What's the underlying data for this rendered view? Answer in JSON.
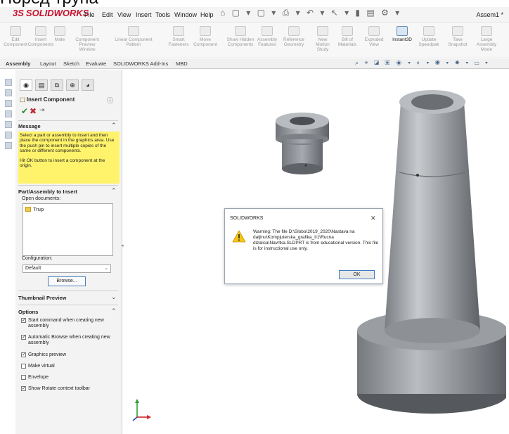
{
  "caption": "Поред трупа",
  "app": {
    "name": "SOLIDWORKS",
    "logo_mark": "3S"
  },
  "menu": {
    "items": [
      "File",
      "Edit",
      "View",
      "Insert",
      "Tools",
      "Window",
      "Help"
    ]
  },
  "document_title": "Assem1 *",
  "ribbon": {
    "buttons": [
      {
        "label": "Edit Component"
      },
      {
        "label": "Insert Components"
      },
      {
        "label": "Mate"
      },
      {
        "label": "Component Preview Window"
      },
      {
        "label": "Linear Component Pattern"
      },
      {
        "label": "Smart Fasteners"
      },
      {
        "label": "Move Component"
      },
      {
        "label": "Show Hidden Components"
      },
      {
        "label": "Assembly Features"
      },
      {
        "label": "Reference Geometry"
      },
      {
        "label": "New Motion Study"
      },
      {
        "label": "Bill of Materials"
      },
      {
        "label": "Exploded View"
      },
      {
        "label": "Instant3D"
      },
      {
        "label": "Update Speedpak"
      },
      {
        "label": "Take Snapshot"
      },
      {
        "label": "Large Assembly Mode"
      }
    ]
  },
  "tabs": [
    "Assembly",
    "Layout",
    "Sketch",
    "Evaluate",
    "SOLIDWORKS Add-Ins",
    "MBD"
  ],
  "property_manager": {
    "title": "Insert Component",
    "message_section": {
      "title": "Message",
      "text1": "Select a part or assembly to insert and then place the component in the graphics area. Use the push pin to insert multiple copies of the same or different components.",
      "text2": "Hit OK button to insert a component at the origin."
    },
    "insert_section": {
      "title": "Part/Assembly to Insert",
      "open_documents_label": "Open documents:",
      "documents": [
        "Trup"
      ],
      "configuration_label": "Configuration:",
      "configuration_value": "Default",
      "browse_label": "Browse..."
    },
    "thumbnail_section": {
      "title": "Thumbnail Preview"
    },
    "options_section": {
      "title": "Options",
      "options": [
        {
          "label": "Start command when creating new assembly",
          "checked": true
        },
        {
          "label": "Automatic Browse when creating new assembly",
          "checked": true
        },
        {
          "label": "Graphics preview",
          "checked": true
        },
        {
          "label": "Make virtual",
          "checked": false
        },
        {
          "label": "Envelope",
          "checked": false
        },
        {
          "label": "Show Rotate context toolbar",
          "checked": true
        }
      ]
    }
  },
  "dialog": {
    "title": "SOLIDWORKS",
    "message": "Warning: The file D:\\Slobo\\2019_2020\\Nastava na daljinu\\Kompjuterska_grafika_II1\\Rucna dizalica\\Navrtka.SLDPRT is from educational version. This file is for instructional use only.",
    "ok_label": "OK"
  },
  "colors": {
    "accent": "#c8102e",
    "warning_bg": "#fff36b",
    "part_gray": "#8e9297"
  }
}
